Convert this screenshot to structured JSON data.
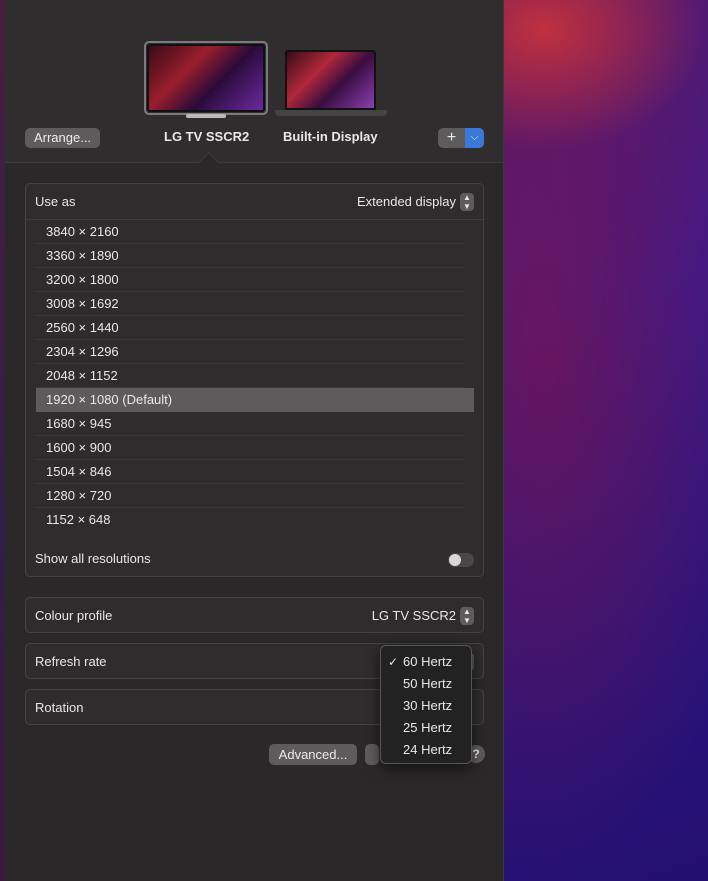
{
  "header": {
    "arrange_label": "Arrange...",
    "displays": [
      {
        "name": "LG TV SSCR2",
        "selected": true
      },
      {
        "name": "Built-in Display",
        "selected": false
      }
    ],
    "add_label": "+",
    "add_dropdown_icon": "chevron-down-icon"
  },
  "use_as": {
    "label": "Use as",
    "value": "Extended display"
  },
  "resolutions": {
    "items": [
      "3840 × 2160",
      "3360 × 1890",
      "3200 × 1800",
      "3008 × 1692",
      "2560 × 1440",
      "2304 × 1296",
      "2048 × 1152",
      "1920 × 1080 (Default)",
      "1680 × 945",
      "1600 × 900",
      "1504 × 846",
      "1280 × 720",
      "1152 × 648"
    ],
    "selected_index": 7,
    "show_all_label": "Show all resolutions",
    "show_all_enabled": false
  },
  "colour_profile": {
    "label": "Colour profile",
    "value": "LG TV SSCR2"
  },
  "refresh_rate": {
    "label": "Refresh rate",
    "options": [
      "60 Hertz",
      "50 Hertz",
      "30 Hertz",
      "25 Hertz",
      "24 Hertz"
    ],
    "selected": "60 Hertz"
  },
  "rotation": {
    "label": "Rotation"
  },
  "footer": {
    "advanced_label": "Advanced...",
    "help_label": "?"
  },
  "colors": {
    "accent": "#3b79d8",
    "selection": "#5e5b5d"
  }
}
